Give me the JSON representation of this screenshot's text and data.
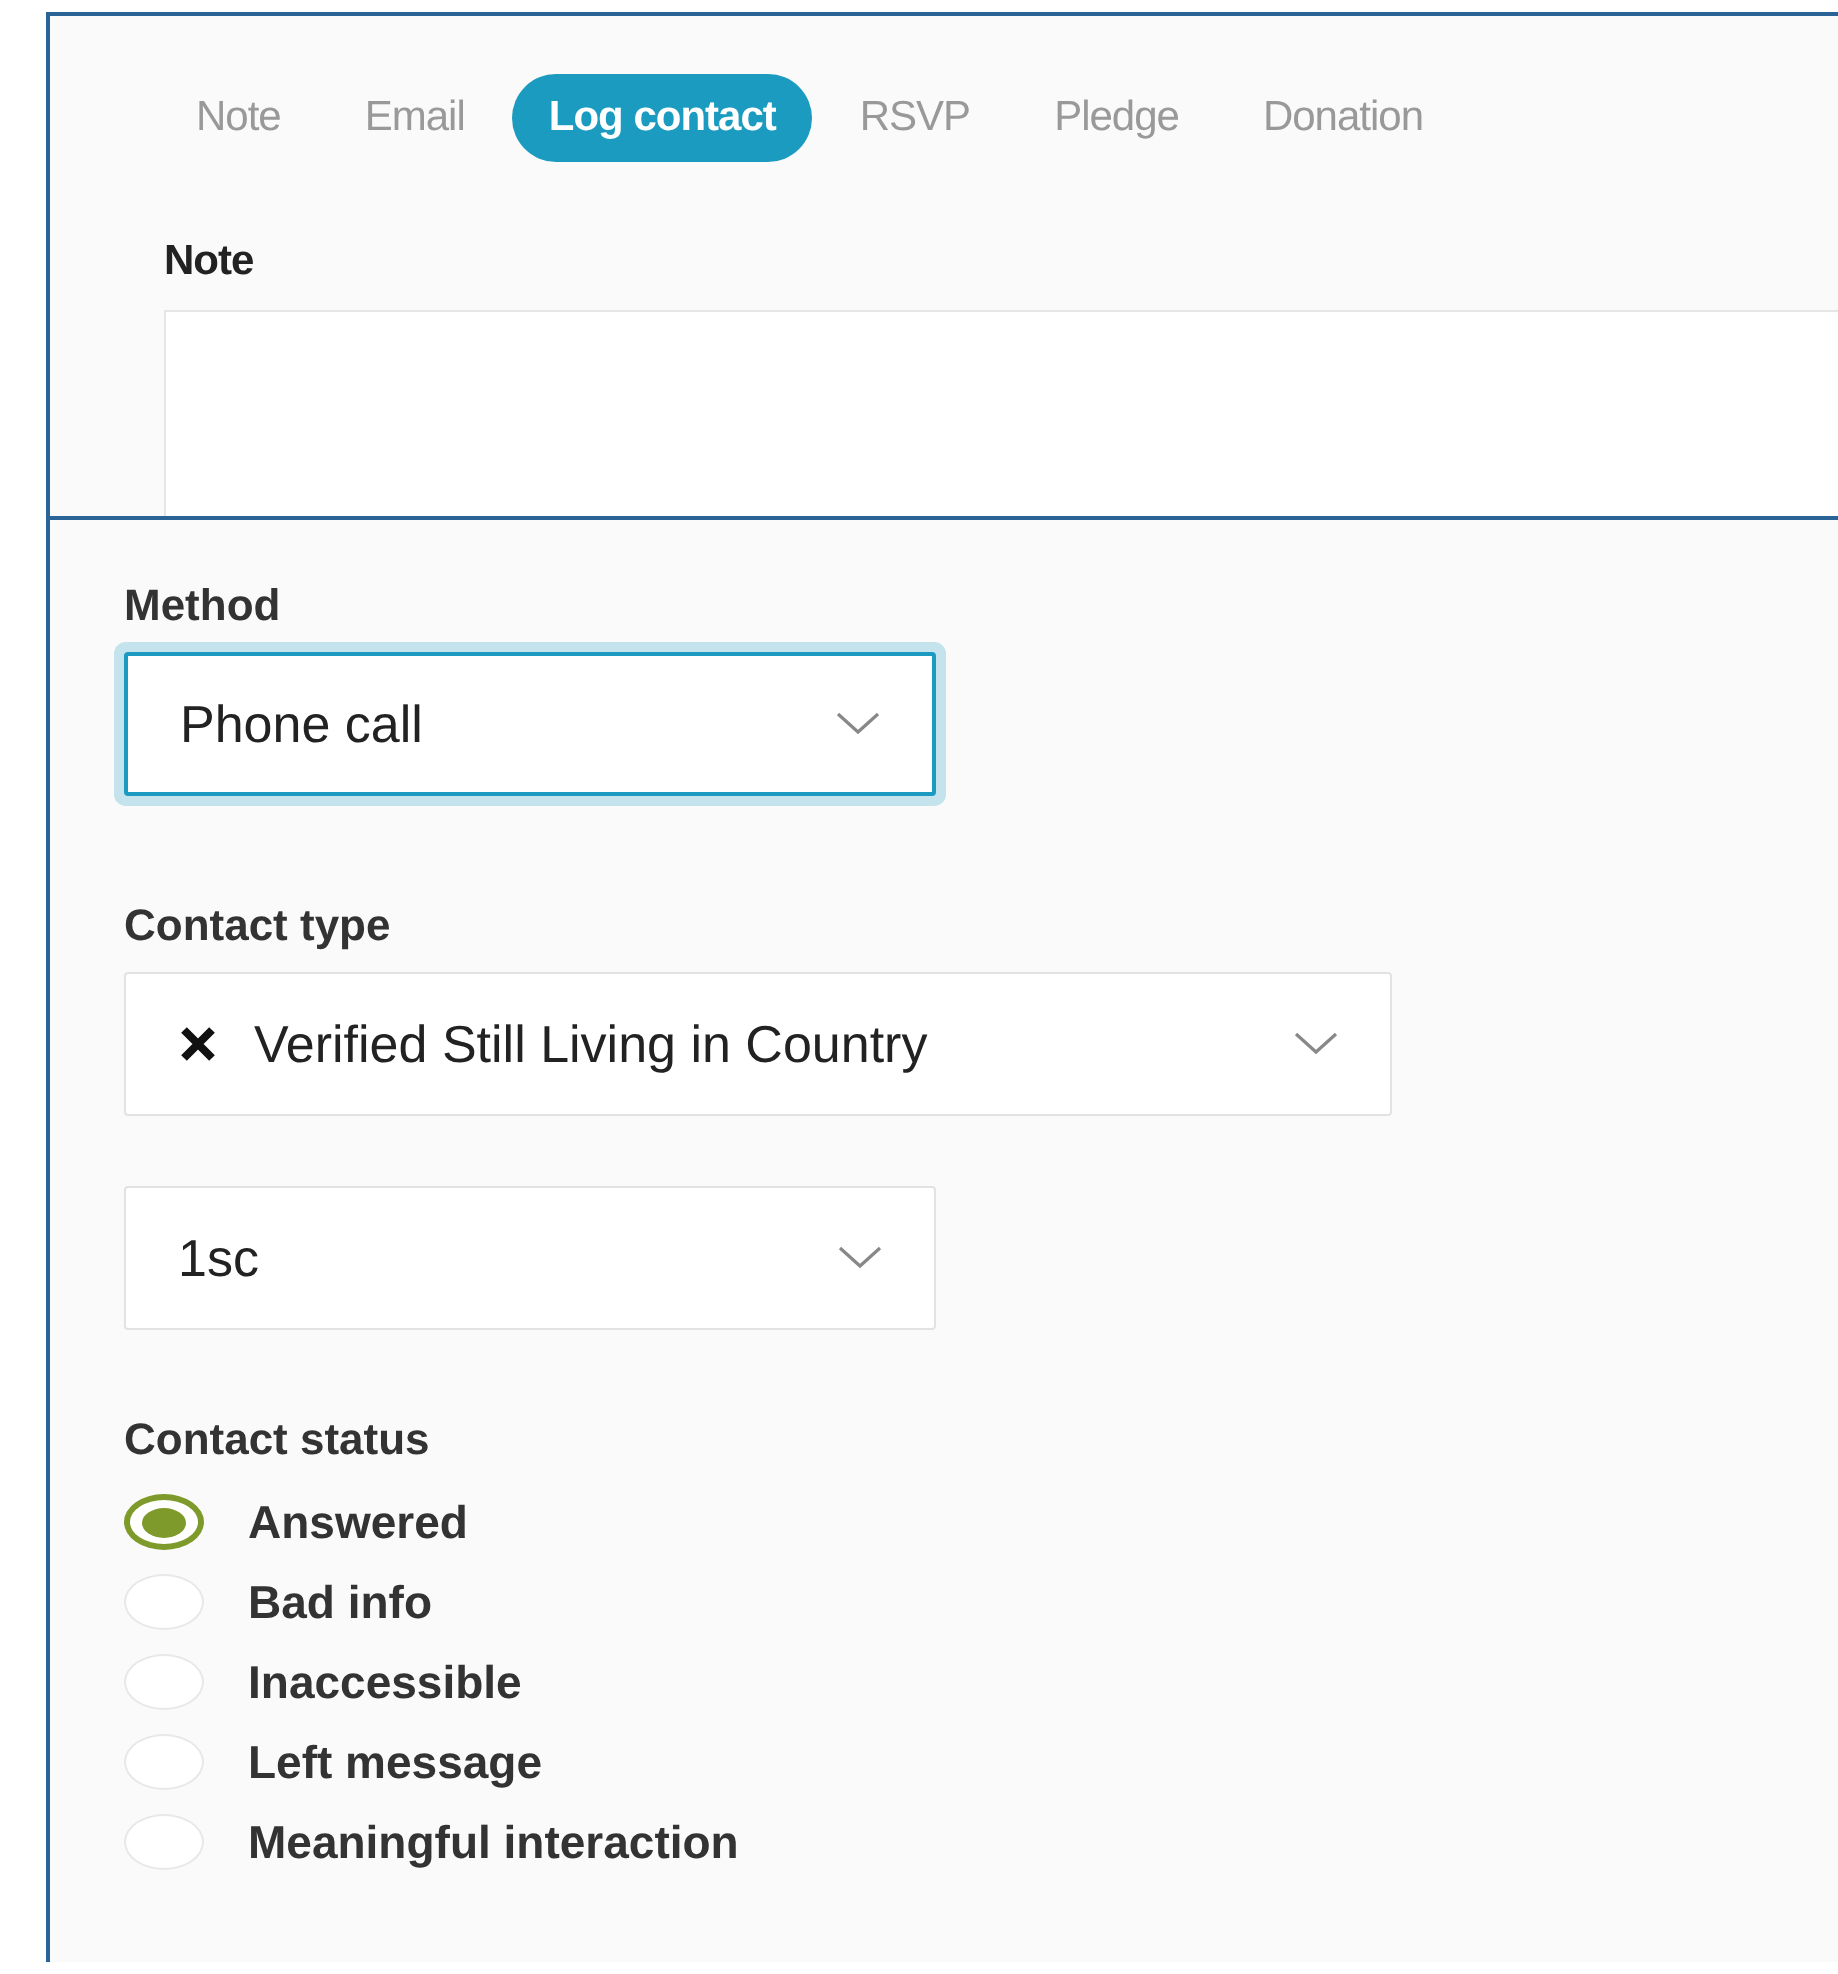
{
  "tabs": [
    {
      "label": "Note",
      "selected": false
    },
    {
      "label": "Email",
      "selected": false
    },
    {
      "label": "Log contact",
      "selected": true
    },
    {
      "label": "RSVP",
      "selected": false
    },
    {
      "label": "Pledge",
      "selected": false
    },
    {
      "label": "Donation",
      "selected": false
    }
  ],
  "note": {
    "label": "Note"
  },
  "method": {
    "label": "Method",
    "value": "Phone call",
    "focused": true
  },
  "contact_type": {
    "label": "Contact type",
    "value": "Verified Still Living in Country",
    "subtype": "1sc"
  },
  "contact_status": {
    "label": "Contact status",
    "options": [
      {
        "label": "Answered",
        "selected": true
      },
      {
        "label": "Bad info",
        "selected": false
      },
      {
        "label": "Inaccessible",
        "selected": false
      },
      {
        "label": "Left message",
        "selected": false
      },
      {
        "label": "Meaningful interaction",
        "selected": false
      }
    ]
  }
}
